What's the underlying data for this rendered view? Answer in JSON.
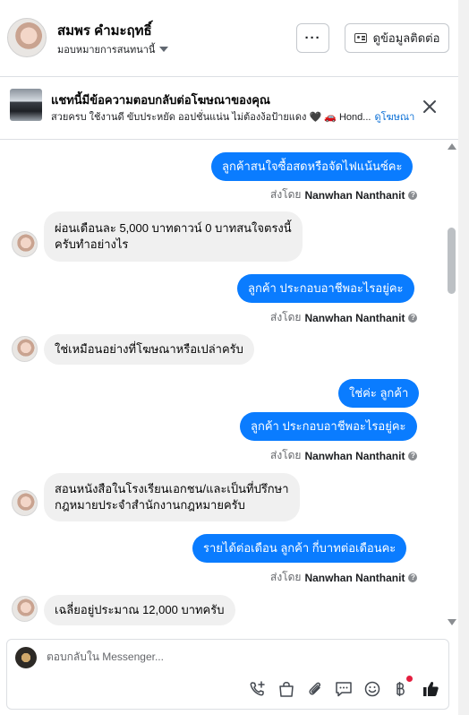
{
  "header": {
    "contact_name": "สมพร คำมะฤทธิ์",
    "assign_label": "มอบหมายการสนทนานี้",
    "more_label": "···",
    "contact_info_label": "ดูข้อมูลติดต่อ"
  },
  "ad": {
    "title": "แชทนี้มีข้อความตอบกลับต่อโฆษณาของคุณ",
    "text": "สวยครบ ใช้งานดี ขับประหยัด ออปชั่นแน่น ไม่ต้องง้อป้ายแดง 🖤 🚗 Hond...",
    "link": "ดูโฆษณา"
  },
  "messages": [
    {
      "side": "out",
      "text": "ลูกค้าสนใจซื้อสดหรือจัดไฟแน้นซ์คะ"
    },
    {
      "side": "in",
      "lines": [
        "ผ่อนเดือนละ 5,000 บาทดาวน์ 0 บาทสนใจตรงนี้",
        "ครับทำอย่างไร"
      ]
    },
    {
      "side": "out",
      "text": "ลูกค้า ประกอบอาชีพอะไรอยู่คะ"
    },
    {
      "side": "in",
      "lines": [
        "ใช่เหมือนอย่างที่โฆษณาหรือเปล่าครับ"
      ]
    },
    {
      "side": "out",
      "text": "ใช่ค่ะ ลูกค้า"
    },
    {
      "side": "out",
      "text": "ลูกค้า ประกอบอาชีพอะไรอยู่คะ"
    },
    {
      "side": "in",
      "lines": [
        "สอนหนังสือในโรงเรียนเอกชน/และเป็นที่ปรึกษา",
        "กฎหมายประจำสำนักงานกฎหมายครับ"
      ]
    },
    {
      "side": "out",
      "text": "รายได้ต่อเดือน ลูกค้า กี่บาทต่อเดือนคะ"
    },
    {
      "side": "in",
      "lines": [
        "เฉลี่ยอยู่ประมาณ 12,000 บาทครับ"
      ]
    }
  ],
  "sent_by": {
    "prefix": "ส่งโดย",
    "name": "Nanwhan Nanthanit",
    "info_symbol": "?"
  },
  "composer": {
    "placeholder": "ตอบกลับใน Messenger..."
  },
  "colors": {
    "outgoing_bubble": "#0a7cff",
    "incoming_bubble": "#f0f0f0",
    "link": "#0a6fd6",
    "like": "#1c1e21"
  },
  "icons": [
    "more-icon",
    "contact-card-icon",
    "close-icon",
    "info-icon",
    "call-add-icon",
    "bag-icon",
    "paperclip-icon",
    "chat-icon",
    "emoji-icon",
    "baht-icon",
    "like-icon"
  ]
}
